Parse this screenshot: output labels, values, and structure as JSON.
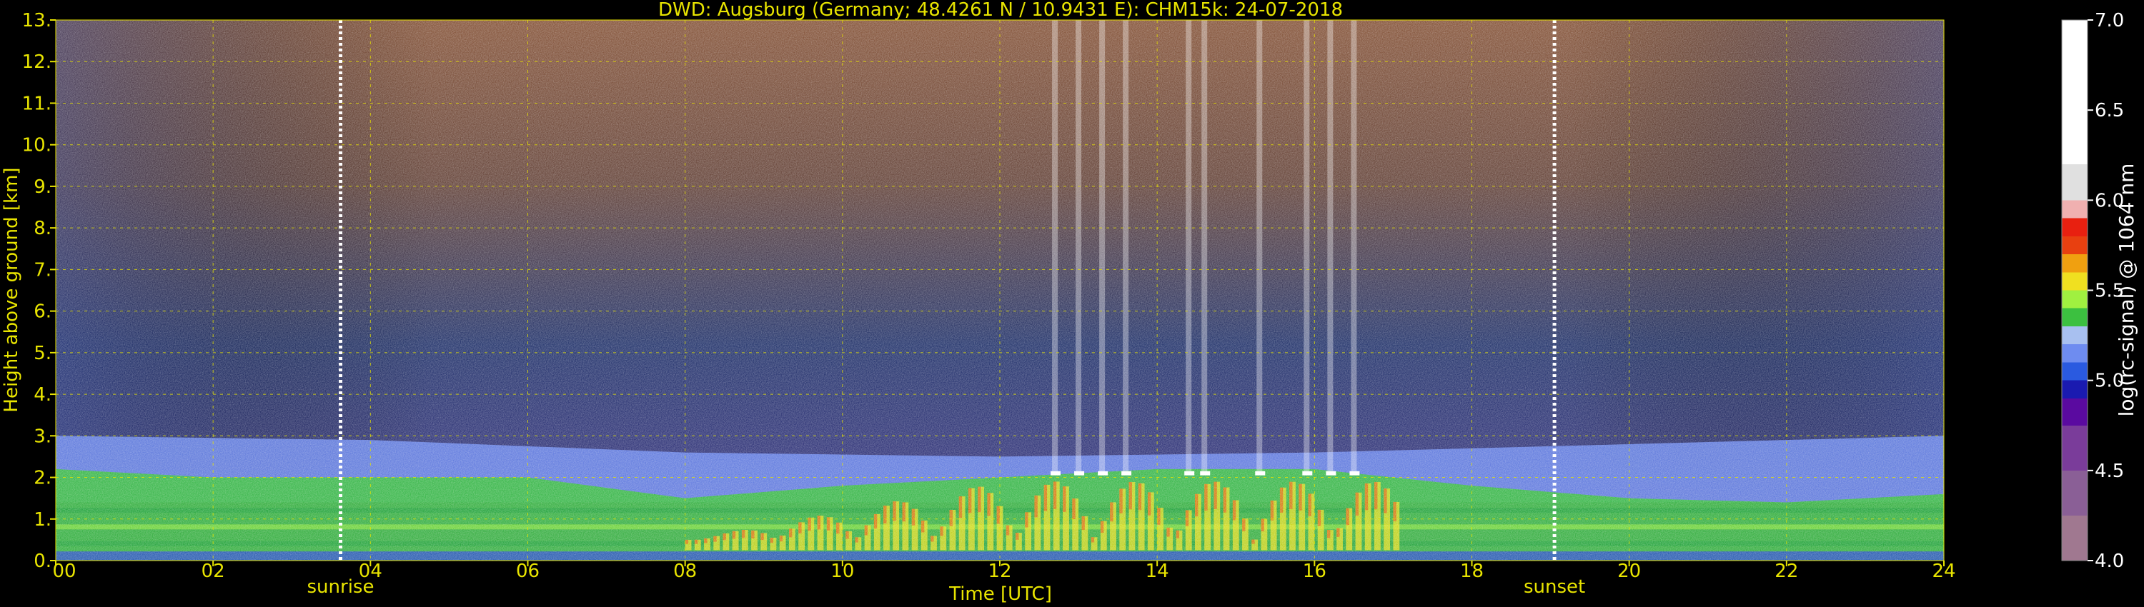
{
  "chart_data": {
    "type": "heatmap",
    "title": "DWD: Augsburg (Germany; 48.4261 N / 10.9431 E):    CHM15k: 24-07-2018",
    "xlabel": "Time [UTC]",
    "ylabel": "Height above ground [km]",
    "xlim": [
      0,
      24
    ],
    "ylim": [
      0,
      13
    ],
    "x_ticks": [
      "00",
      "02",
      "04",
      "06",
      "08",
      "10",
      "12",
      "14",
      "16",
      "18",
      "20",
      "22",
      "24"
    ],
    "y_ticks": [
      "0.",
      "1.",
      "2.",
      "3.",
      "4.",
      "5.",
      "6.",
      "7.",
      "8.",
      "9.",
      "10.",
      "11.",
      "12.",
      "13."
    ],
    "grid": true,
    "markers": [
      {
        "label": "sunrise",
        "time": 3.62
      },
      {
        "label": "sunset",
        "time": 19.05
      }
    ],
    "colorbar": {
      "label": "log(rc-signal) @ 1064 nm",
      "range": [
        4.0,
        7.0
      ],
      "ticks": [
        "4.0",
        "4.5",
        "5.0",
        "5.5",
        "6.0",
        "6.5",
        "7.0"
      ],
      "stops": [
        {
          "value": 4.0,
          "color": "#a07890"
        },
        {
          "value": 4.25,
          "color": "#8a5f96"
        },
        {
          "value": 4.5,
          "color": "#7a3c9a"
        },
        {
          "value": 4.75,
          "color": "#5a0aa0"
        },
        {
          "value": 4.9,
          "color": "#1a1ab0"
        },
        {
          "value": 5.0,
          "color": "#2a5ae0"
        },
        {
          "value": 5.1,
          "color": "#6e8cf0"
        },
        {
          "value": 5.2,
          "color": "#a8c0f0"
        },
        {
          "value": 5.3,
          "color": "#3cc040"
        },
        {
          "value": 5.4,
          "color": "#a0f040"
        },
        {
          "value": 5.5,
          "color": "#f0e020"
        },
        {
          "value": 5.6,
          "color": "#f0a010"
        },
        {
          "value": 5.7,
          "color": "#e84010"
        },
        {
          "value": 5.8,
          "color": "#e82010"
        },
        {
          "value": 5.9,
          "color": "#f0b0b0"
        },
        {
          "value": 6.0,
          "color": "#e0e0e0"
        },
        {
          "value": 6.2,
          "color": "#ffffff"
        },
        {
          "value": 7.0,
          "color": "#ffffff"
        }
      ]
    },
    "features": [
      {
        "name": "boundary-layer-mixed",
        "t_start": 0,
        "t_end": 24,
        "h_top_profile": [
          [
            0,
            2.2
          ],
          [
            2,
            2.0
          ],
          [
            6,
            2.0
          ],
          [
            8,
            1.5
          ],
          [
            10,
            1.8
          ],
          [
            12,
            2.0
          ],
          [
            14,
            2.2
          ],
          [
            16,
            2.2
          ],
          [
            17,
            2.0
          ],
          [
            18,
            1.8
          ],
          [
            20,
            1.5
          ],
          [
            22,
            1.4
          ],
          [
            24,
            1.6
          ]
        ],
        "value": 5.3
      },
      {
        "name": "residual-layer",
        "t_start": 0,
        "t_end": 24,
        "h_bottom": 2.0,
        "h_top_profile": [
          [
            0,
            3.0
          ],
          [
            4,
            2.9
          ],
          [
            8,
            2.6
          ],
          [
            12,
            2.5
          ],
          [
            16,
            2.6
          ],
          [
            18,
            2.7
          ],
          [
            20,
            2.8
          ],
          [
            24,
            3.0
          ]
        ],
        "value": 5.1
      },
      {
        "name": "convective-plumes",
        "t_start": 8,
        "t_end": 17,
        "h_top": 2.1,
        "value": 5.55
      },
      {
        "name": "cloud-base",
        "times": [
          12.7,
          13.0,
          13.3,
          13.6,
          14.4,
          14.6,
          15.3,
          15.9,
          16.2,
          16.5
        ],
        "height": 2.05,
        "value": 6.2
      },
      {
        "name": "free-troposphere-noise",
        "h_bottom": 3.0,
        "h_top": 13.0,
        "value": 4.8
      }
    ]
  }
}
